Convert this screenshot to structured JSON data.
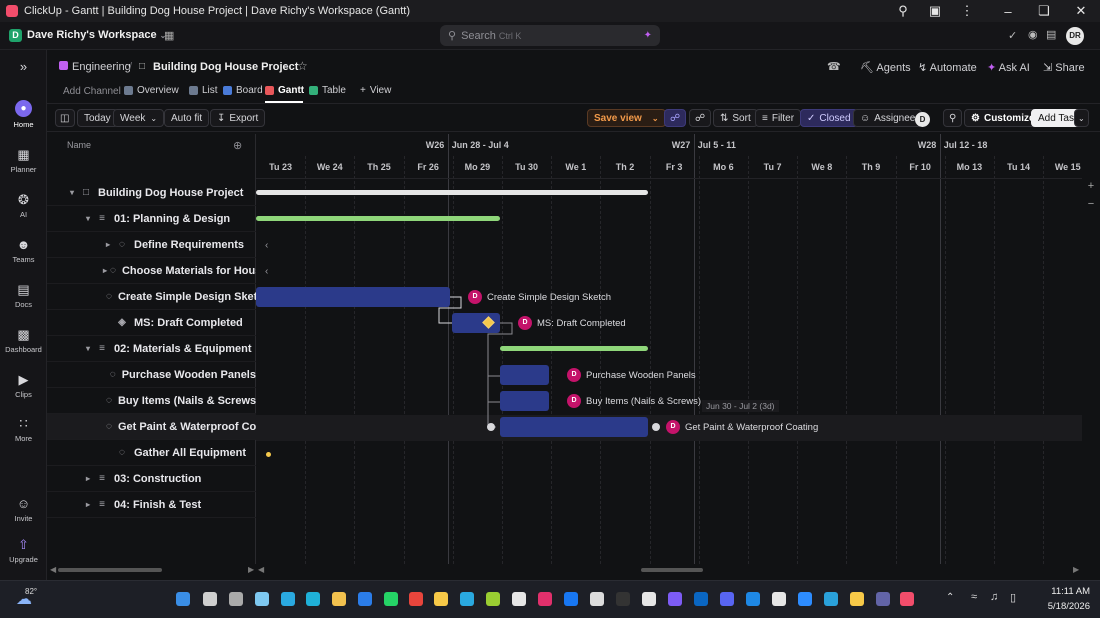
{
  "window": {
    "title": "ClickUp - Gantt | Building Dog House Project | Dave Richy's Workspace (Gantt)"
  },
  "workspace": {
    "badge": "D",
    "name": "Dave Richy's Workspace",
    "search_placeholder": "Search",
    "search_shortcut": "Ctrl K",
    "avatar": "DR"
  },
  "sidebar": {
    "items": [
      {
        "label": "Home",
        "icon": "home-icon"
      },
      {
        "label": "Planner",
        "icon": "calendar-icon"
      },
      {
        "label": "AI",
        "icon": "ai-icon"
      },
      {
        "label": "Teams",
        "icon": "teams-icon"
      },
      {
        "label": "Docs",
        "icon": "docs-icon"
      },
      {
        "label": "Dashboard",
        "icon": "dashboard-icon"
      },
      {
        "label": "Clips",
        "icon": "clips-icon"
      },
      {
        "label": "More",
        "icon": "more-icon"
      },
      {
        "label": "Invite",
        "icon": "invite-icon"
      },
      {
        "label": "Upgrade",
        "icon": "upgrade-icon"
      }
    ]
  },
  "breadcrumb": {
    "space": "Engineering",
    "sep": "/",
    "project": "Building Dog House Project"
  },
  "header_actions": {
    "agents": "Agents",
    "automate": "Automate",
    "ask_ai": "Ask AI",
    "share": "Share"
  },
  "views": {
    "add_channel": "Add Channel",
    "tabs": [
      "Overview",
      "List",
      "Board",
      "Gantt",
      "Table"
    ],
    "active": "Gantt",
    "add_view": "View"
  },
  "toolbar": {
    "today": "Today",
    "week": "Week",
    "autofit": "Auto fit",
    "export": "Export",
    "save_view": "Save view",
    "sort": "Sort",
    "filter": "Filter",
    "closed": "Closed",
    "assignee": "Assignee",
    "assignee_avatar": "D",
    "customize": "Customize",
    "add_task": "Add Task"
  },
  "panel": {
    "name_header": "Name"
  },
  "rows": [
    {
      "label": "Building Dog House Project",
      "level": 0,
      "type": "folder"
    },
    {
      "label": "01: Planning & Design",
      "level": 1,
      "type": "list"
    },
    {
      "label": "Define Requirements",
      "level": 2,
      "type": "task"
    },
    {
      "label": "Choose Materials for House",
      "level": 2,
      "type": "task"
    },
    {
      "label": "Create Simple Design Sketch",
      "level": 2,
      "type": "task"
    },
    {
      "label": "MS: Draft Completed",
      "level": 2,
      "type": "milestone"
    },
    {
      "label": "02: Materials & Equipment",
      "level": 1,
      "type": "list"
    },
    {
      "label": "Purchase Wooden Panels",
      "level": 2,
      "type": "task"
    },
    {
      "label": "Buy Items (Nails & Screws)",
      "level": 2,
      "type": "task"
    },
    {
      "label": "Get Paint & Waterproof Coating",
      "level": 2,
      "type": "task"
    },
    {
      "label": "Gather All Equipment",
      "level": 2,
      "type": "task"
    },
    {
      "label": "03: Construction",
      "level": 1,
      "type": "list"
    },
    {
      "label": "04: Finish & Test",
      "level": 1,
      "type": "list"
    }
  ],
  "timeline": {
    "weeks": [
      {
        "label": "W26",
        "range": "Jun 28 - Jul 4"
      },
      {
        "label": "W27",
        "range": "Jul 5 - 11"
      },
      {
        "label": "W28",
        "range": "Jul 12 - 18"
      }
    ],
    "days": [
      "Tu 23",
      "We 24",
      "Th 25",
      "Fr 26",
      "Mo 29",
      "Tu 30",
      "We 1",
      "Th 2",
      "Fr 3",
      "Mo 6",
      "Tu 7",
      "We 8",
      "Th 9",
      "Fr 10",
      "Mo 13",
      "Tu 14",
      "We 15"
    ]
  },
  "bars": {
    "design_sketch": {
      "label": "Create Simple Design Sketch",
      "avatar": "D"
    },
    "draft": {
      "label": "MS: Draft Completed",
      "avatar": "D"
    },
    "panels": {
      "label": "Purchase Wooden Panels",
      "avatar": "D"
    },
    "nails": {
      "label": "Buy Items (Nails & Screws)",
      "avatar": "D"
    },
    "paint": {
      "label": "Get Paint & Waterproof Coating",
      "avatar": "D",
      "tooltip": "Jun 30 - Jul 2 (3d)"
    }
  },
  "colors": {
    "accent": "#7b68ee",
    "bar": "#2b3a8a",
    "summary_white": "#e6e6e6",
    "summary_green": "#8fd67a",
    "milestone": "#f5c84c",
    "save_view": "#f29a4a"
  },
  "tray": {
    "weather": "82°",
    "time": "11:11 AM",
    "date": "5/18/2026"
  }
}
